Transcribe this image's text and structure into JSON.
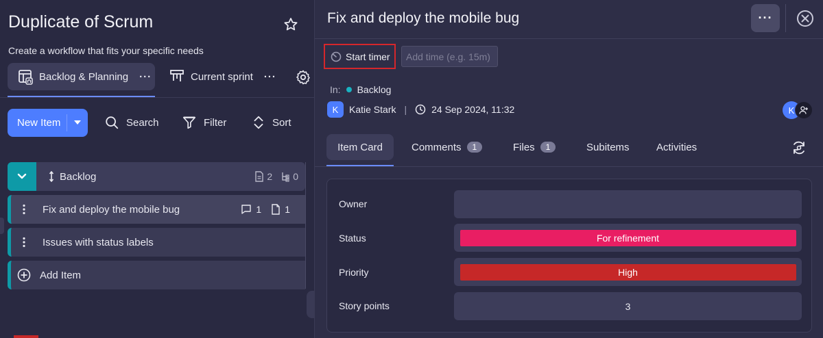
{
  "board": {
    "title": "Duplicate of Scrum",
    "subtitle": "Create a workflow that fits your specific needs",
    "views": [
      {
        "label": "Backlog & Planning",
        "more": "···"
      },
      {
        "label": "Current sprint",
        "more": "···"
      }
    ]
  },
  "toolbar": {
    "new_item": "New Item",
    "search": "Search",
    "filter": "Filter",
    "sort": "Sort"
  },
  "group": {
    "name": "Backlog",
    "doc_count": "2",
    "sub_count": "0"
  },
  "items": [
    {
      "label": "Fix and deploy the mobile bug",
      "comments": "1",
      "files": "1"
    },
    {
      "label": "Issues with status labels"
    }
  ],
  "add_item": "Add Item",
  "card": {
    "title": "Fix and deploy the mobile bug",
    "more": "···",
    "start_timer": "Start timer",
    "add_time_placeholder": "Add time (e.g. 15m)",
    "in_label": "In:",
    "group": "Backlog",
    "author_initial": "K",
    "author": "Katie Stark",
    "date": "24 Sep 2024, 11:32",
    "assignee_initial": "K",
    "tabs": [
      {
        "label": "Item Card"
      },
      {
        "label": "Comments",
        "badge": "1"
      },
      {
        "label": "Files",
        "badge": "1"
      },
      {
        "label": "Subitems"
      },
      {
        "label": "Activities"
      }
    ],
    "fields": {
      "owner_label": "Owner",
      "owner_value": "",
      "status_label": "Status",
      "status_value": "For refinement",
      "priority_label": "Priority",
      "priority_value": "High",
      "points_label": "Story points",
      "points_value": "3"
    }
  },
  "colors": {
    "accent": "#4d7dff",
    "group": "#0e9aa7",
    "status": "#e91e63",
    "priority": "#c62828"
  }
}
